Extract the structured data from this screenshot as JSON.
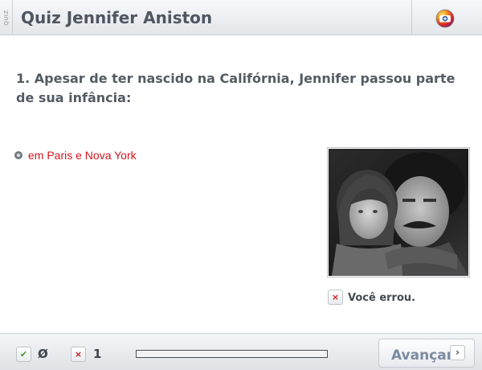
{
  "header": {
    "side_tag": "QUIZ",
    "title": "Quiz Jennifer Aniston",
    "logo_icon": "globo-logo-icon"
  },
  "question": {
    "text": "1. Apesar de ter nascido na Califórnia, Jennifer passou parte de sua infância:"
  },
  "answer": {
    "selected_text": "em Paris e Nova York",
    "color": "#d6161d"
  },
  "photo": {
    "icon": "black-and-white-photo"
  },
  "result": {
    "icon": "wrong-x-icon",
    "icon_glyph": "×",
    "text": "Você errou."
  },
  "footer": {
    "correct_icon_glyph": "✔",
    "correct_count": "Ø",
    "wrong_icon_glyph": "×",
    "wrong_count": "1",
    "progress": 0,
    "next_label": "Avançar",
    "next_icon_glyph": "›"
  }
}
